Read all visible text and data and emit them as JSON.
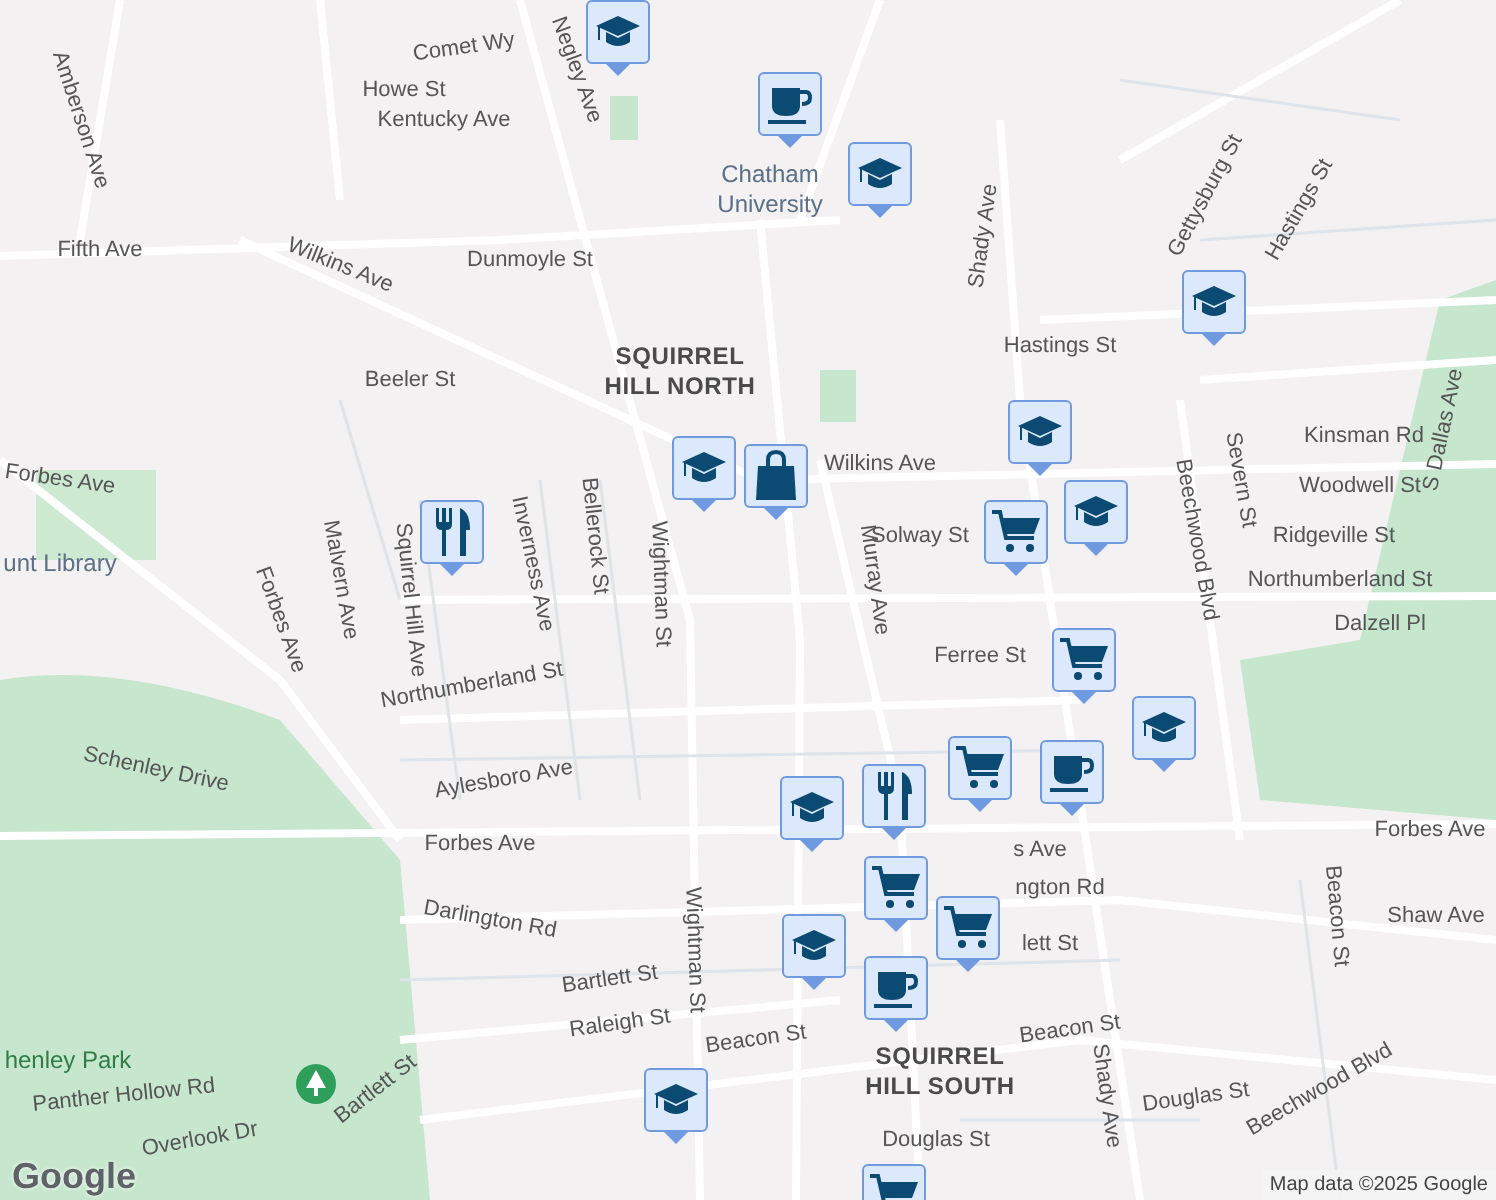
{
  "labels": [
    {
      "text": "Amberson Ave",
      "kind": "street"
    },
    {
      "text": "Comet Wy",
      "kind": "street"
    },
    {
      "text": "Howe St",
      "kind": "street"
    },
    {
      "text": "Kentucky Ave",
      "kind": "street"
    },
    {
      "text": "Negley Ave",
      "kind": "street"
    },
    {
      "text": "Chatham University",
      "kind": "poi"
    },
    {
      "text": "Fifth Ave",
      "kind": "street"
    },
    {
      "text": "Wilkins Ave",
      "kind": "street"
    },
    {
      "text": "Dunmoyle St",
      "kind": "street"
    },
    {
      "text": "Shady Ave",
      "kind": "street"
    },
    {
      "text": "Gettysburg St",
      "kind": "street"
    },
    {
      "text": "Hastings St",
      "kind": "street"
    },
    {
      "text": "Hastings St",
      "kind": "street"
    },
    {
      "text": "Beeler St",
      "kind": "street"
    },
    {
      "text": "SQUIRREL HILL NORTH",
      "kind": "area"
    },
    {
      "text": "Forbes Ave",
      "kind": "street"
    },
    {
      "text": "Kinsman Rd",
      "kind": "street"
    },
    {
      "text": "Woodwell St",
      "kind": "street"
    },
    {
      "text": "Ridgeville St",
      "kind": "street"
    },
    {
      "text": "Northumberland St",
      "kind": "street"
    },
    {
      "text": "Dalzell Pl",
      "kind": "street"
    },
    {
      "text": "Wilkins Ave",
      "kind": "street"
    },
    {
      "text": "Solway St",
      "kind": "street"
    },
    {
      "text": "Murray Ave",
      "kind": "street"
    },
    {
      "text": "Beechwood Blvd",
      "kind": "street"
    },
    {
      "text": "Severn St",
      "kind": "street"
    },
    {
      "text": "S Dallas Ave",
      "kind": "street"
    },
    {
      "text": "Wightman St",
      "kind": "street"
    },
    {
      "text": "Bellerock St",
      "kind": "street"
    },
    {
      "text": "Inverness Ave",
      "kind": "street"
    },
    {
      "text": "Malvern Ave",
      "kind": "street"
    },
    {
      "text": "Squirrel Hill Ave",
      "kind": "street"
    },
    {
      "text": "Forbes Ave",
      "kind": "street"
    },
    {
      "text": "unt Library",
      "kind": "poi"
    },
    {
      "text": "Ferree St",
      "kind": "street"
    },
    {
      "text": "Northumberland St",
      "kind": "street"
    },
    {
      "text": "Aylesboro Ave",
      "kind": "street"
    },
    {
      "text": "Schenley Drive",
      "kind": "street"
    },
    {
      "text": "Forbes Ave",
      "kind": "street"
    },
    {
      "text": "s Ave",
      "kind": "street"
    },
    {
      "text": "Forbes Ave",
      "kind": "street"
    },
    {
      "text": "Wightman St",
      "kind": "street"
    },
    {
      "text": "Darlington Rd",
      "kind": "street"
    },
    {
      "text": "ngton Rd",
      "kind": "street"
    },
    {
      "text": "Bartlett St",
      "kind": "street"
    },
    {
      "text": "lett St",
      "kind": "street"
    },
    {
      "text": "Raleigh St",
      "kind": "street"
    },
    {
      "text": "Beacon St",
      "kind": "street"
    },
    {
      "text": "Beacon St",
      "kind": "street"
    },
    {
      "text": "SQUIRREL HILL SOUTH",
      "kind": "area"
    },
    {
      "text": "Shaw Ave",
      "kind": "street"
    },
    {
      "text": "Beacon St",
      "kind": "street"
    },
    {
      "text": "Shady Ave",
      "kind": "street"
    },
    {
      "text": "Douglas St",
      "kind": "street"
    },
    {
      "text": "Douglas St",
      "kind": "street"
    },
    {
      "text": "Beechwood Blvd",
      "kind": "street"
    },
    {
      "text": "henley Park",
      "kind": "park"
    },
    {
      "text": "Panther Hollow Rd",
      "kind": "street"
    },
    {
      "text": "Overlook Dr",
      "kind": "street"
    },
    {
      "text": "Bartlett St",
      "kind": "street"
    }
  ],
  "pins": [
    {
      "kind": "school"
    },
    {
      "kind": "cafe"
    },
    {
      "kind": "school"
    },
    {
      "kind": "school"
    },
    {
      "kind": "school"
    },
    {
      "kind": "bag"
    },
    {
      "kind": "school"
    },
    {
      "kind": "restaurant"
    },
    {
      "kind": "cart"
    },
    {
      "kind": "school"
    },
    {
      "kind": "cart"
    },
    {
      "kind": "school"
    },
    {
      "kind": "cart"
    },
    {
      "kind": "cafe"
    },
    {
      "kind": "school"
    },
    {
      "kind": "restaurant"
    },
    {
      "kind": "cart"
    },
    {
      "kind": "cart"
    },
    {
      "kind": "school"
    },
    {
      "kind": "cafe"
    },
    {
      "kind": "school"
    },
    {
      "kind": "cart"
    }
  ],
  "attribution": "Map data ©2025 Google",
  "logo": "Google"
}
